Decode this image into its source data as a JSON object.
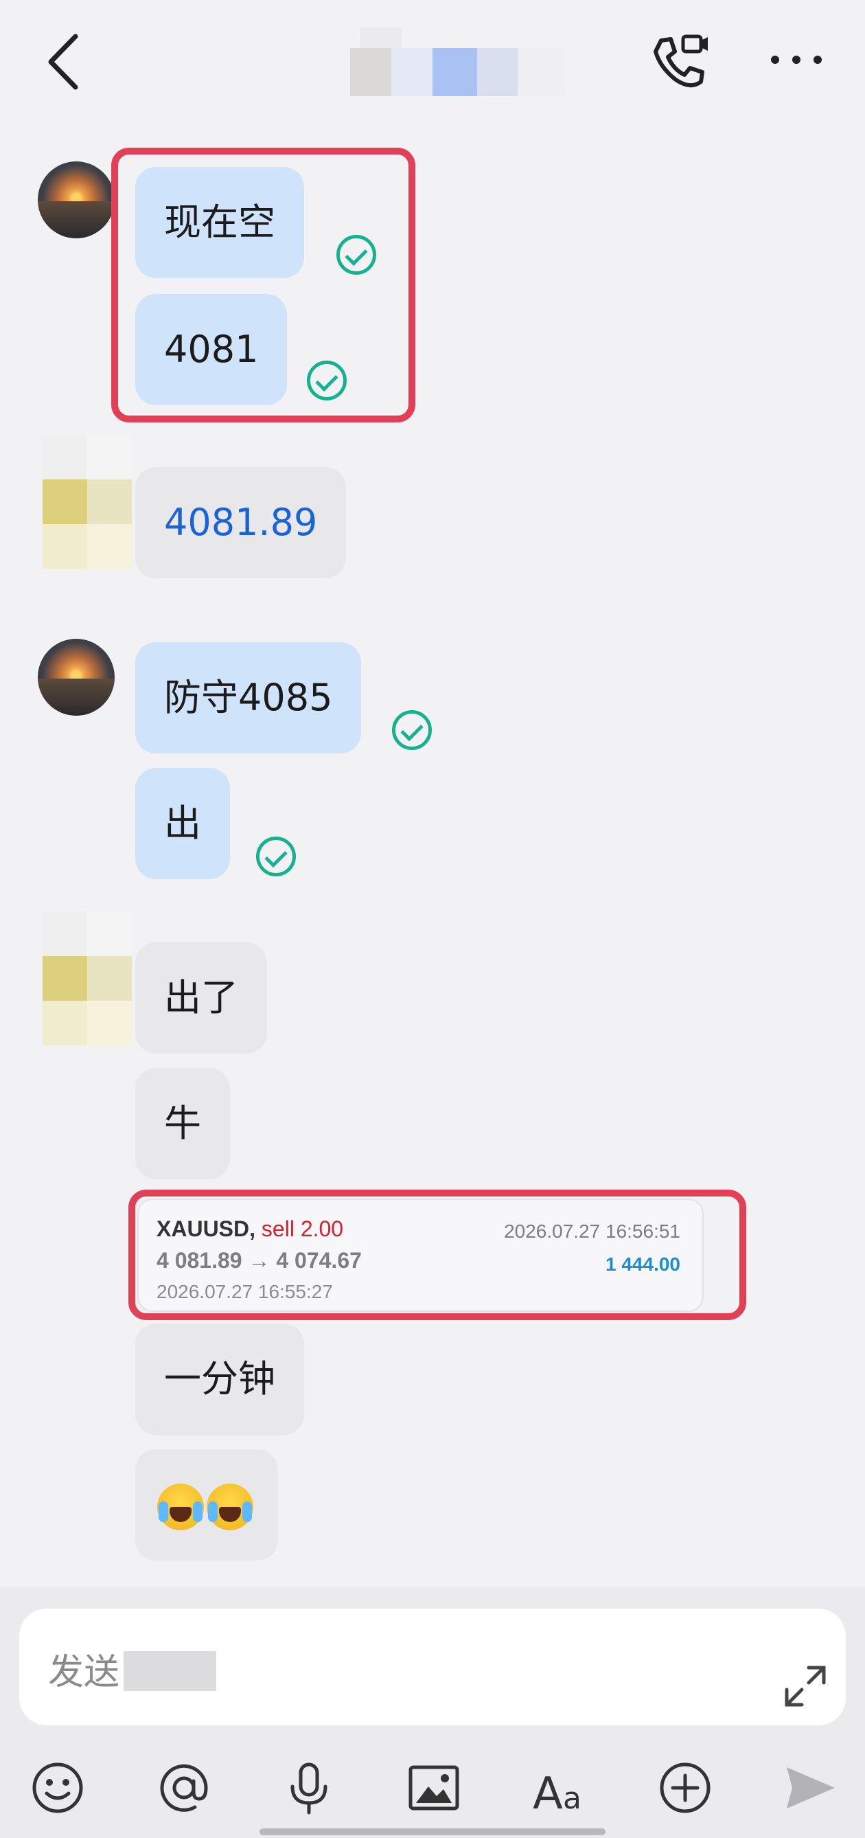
{
  "header": {
    "back_icon": "chevron-left-icon",
    "call_icon": "phone-video-icon",
    "more_icon": "ellipsis-icon"
  },
  "messages": {
    "m1": "现在空",
    "m2": "4081",
    "m3": "4081.89",
    "m4": "防守4085",
    "m5": "出",
    "m6": "出了",
    "m7": "牛",
    "m9": "一分钟"
  },
  "trade_card": {
    "symbol": "XAUUSD,",
    "side": "sell 2.00",
    "close_time": "2026.07.27 16:56:51",
    "prices": "4 081.89 → 4 074.67",
    "profit": "1 444.00",
    "open_time": "2026.07.27 16:55:27"
  },
  "emoji_message": [
    "crying-laughing-emoji",
    "crying-laughing-emoji"
  ],
  "colors": {
    "my_bubble": "#cfe3fb",
    "other_bubble": "#e8e8eb",
    "highlight": "#e04156",
    "read_check": "#16b28f",
    "link": "#1a63d6",
    "sell": "#d2202f",
    "profit": "#1d8fd0"
  },
  "input": {
    "placeholder": "发送"
  },
  "toolbar": [
    "emoji-icon",
    "mention-icon",
    "microphone-icon",
    "image-icon",
    "font-icon",
    "plus-icon",
    "send-icon"
  ]
}
